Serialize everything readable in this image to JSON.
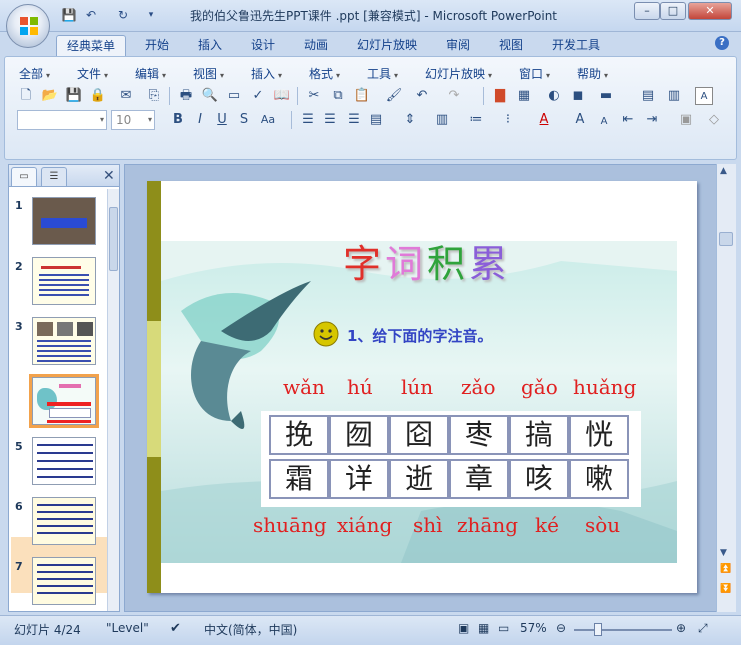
{
  "window": {
    "title": "我的伯父鲁迅先生PPT课件 .ppt [兼容模式] - Microsoft PowerPoint",
    "minimize": "–",
    "maximize": "□",
    "close": "✕"
  },
  "tabs": [
    "经典菜单",
    "开始",
    "插入",
    "设计",
    "动画",
    "幻灯片放映",
    "审阅",
    "视图",
    "开发工具"
  ],
  "help": "?",
  "menus": [
    "全部",
    "文件",
    "编辑",
    "视图",
    "插入",
    "格式",
    "工具",
    "幻灯片放映",
    "窗口",
    "帮助"
  ],
  "font_size": "10",
  "slides_panel": {
    "numbers": [
      "1",
      "2",
      "3",
      "4",
      "5",
      "6",
      "7"
    ],
    "selected": 4
  },
  "slide": {
    "title_chars": [
      {
        "ch": "字",
        "color": "#e0302a"
      },
      {
        "ch": "词",
        "color": "#e07ad8"
      },
      {
        "ch": "积",
        "color": "#2fa33b"
      },
      {
        "ch": "累",
        "color": "#8a5ed8"
      }
    ],
    "instruction": "1、给下面的字注音。",
    "pinyin_top": [
      "wǎn",
      "hú",
      "lún",
      "zǎo",
      "gǎo",
      "huǎng"
    ],
    "chars_row1": [
      "挽",
      "囫",
      "囵",
      "枣",
      "搞",
      "恍"
    ],
    "chars_row2": [
      "霜",
      "详",
      "逝",
      "章",
      "咳",
      "嗽"
    ],
    "pinyin_bottom": [
      "shuāng",
      "xiáng",
      "shì",
      "zhāng",
      "ké",
      "sòu"
    ]
  },
  "status": {
    "slide_indicator": "幻灯片 4/24",
    "theme": "\"Level\"",
    "language": "中文(简体，中国)",
    "zoom": "57%"
  }
}
